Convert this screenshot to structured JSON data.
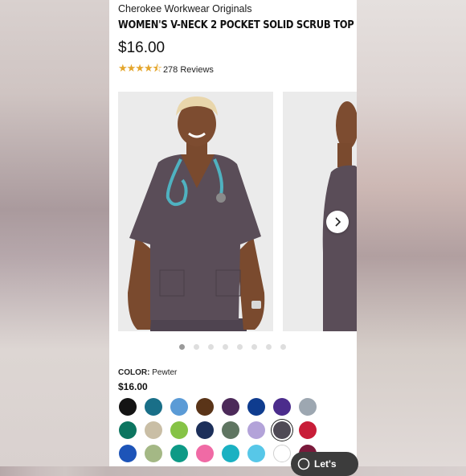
{
  "product": {
    "brand": "Cherokee Workwear Originals",
    "title": "WOMEN'S V-NECK 2 POCKET SOLID SCRUB TOP",
    "price": "$16.00",
    "rating": 4.5,
    "stars_display": "★★★★⯪",
    "reviews": "278 Reviews"
  },
  "gallery": {
    "images": [
      "model-front",
      "model-side"
    ],
    "page_count": 8,
    "active_index": 0
  },
  "options": {
    "color_label": "COLOR:",
    "color_value": "Pewter",
    "price": "$16.00",
    "swatches": [
      {
        "name": "black",
        "hex": "#141414"
      },
      {
        "name": "teal blue",
        "hex": "#196f88"
      },
      {
        "name": "ceil blue",
        "hex": "#5b9bd6"
      },
      {
        "name": "brown",
        "hex": "#5a3418"
      },
      {
        "name": "eggplant",
        "hex": "#4c2a59"
      },
      {
        "name": "royal",
        "hex": "#0f3c8f"
      },
      {
        "name": "purple",
        "hex": "#4b2c8c"
      },
      {
        "name": "gray",
        "hex": "#9da7b1"
      },
      {
        "name": "hunter green",
        "hex": "#0c7560"
      },
      {
        "name": "khaki",
        "hex": "#c9bea5"
      },
      {
        "name": "lime",
        "hex": "#86c346"
      },
      {
        "name": "navy",
        "hex": "#1c2f5a"
      },
      {
        "name": "olive",
        "hex": "#5f7561"
      },
      {
        "name": "lavender",
        "hex": "#b3a3d9"
      },
      {
        "name": "pewter",
        "hex": "#4f4a55",
        "selected": true
      },
      {
        "name": "red",
        "hex": "#c81d38"
      },
      {
        "name": "galaxy blue",
        "hex": "#1d54b8"
      },
      {
        "name": "sage",
        "hex": "#a4b885"
      },
      {
        "name": "jade",
        "hex": "#0e9a86"
      },
      {
        "name": "pink",
        "hex": "#f06aa5"
      },
      {
        "name": "turquoise",
        "hex": "#1ab1c2"
      },
      {
        "name": "sky",
        "hex": "#57c7e8"
      },
      {
        "name": "white",
        "hex": "#ffffff"
      },
      {
        "name": "wine",
        "hex": "#7a1a3b"
      }
    ]
  },
  "colors": {
    "star": "#e4a62d",
    "scrub": "#584c57"
  },
  "chat": {
    "label": "Let's"
  }
}
